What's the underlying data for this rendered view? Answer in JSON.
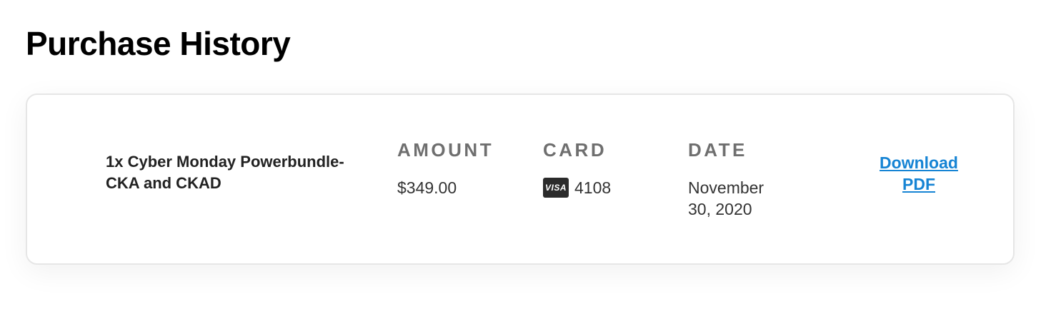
{
  "page": {
    "title": "Purchase History"
  },
  "purchase": {
    "product": "1x Cyber Monday Powerbundle-CKA and CKAD",
    "amount_label": "AMOUNT",
    "amount_value": "$349.00",
    "card_label": "CARD",
    "card_brand": "VISA",
    "card_last4": "4108",
    "date_label": "DATE",
    "date_value": "November 30, 2020",
    "download_label": "Download PDF"
  },
  "colors": {
    "link": "#1684d4",
    "heading": "#000000",
    "column_header": "#6f6f6f",
    "card_border": "#e6e6e6"
  },
  "icons": {
    "card_brand_icon": "visa-card-icon"
  }
}
